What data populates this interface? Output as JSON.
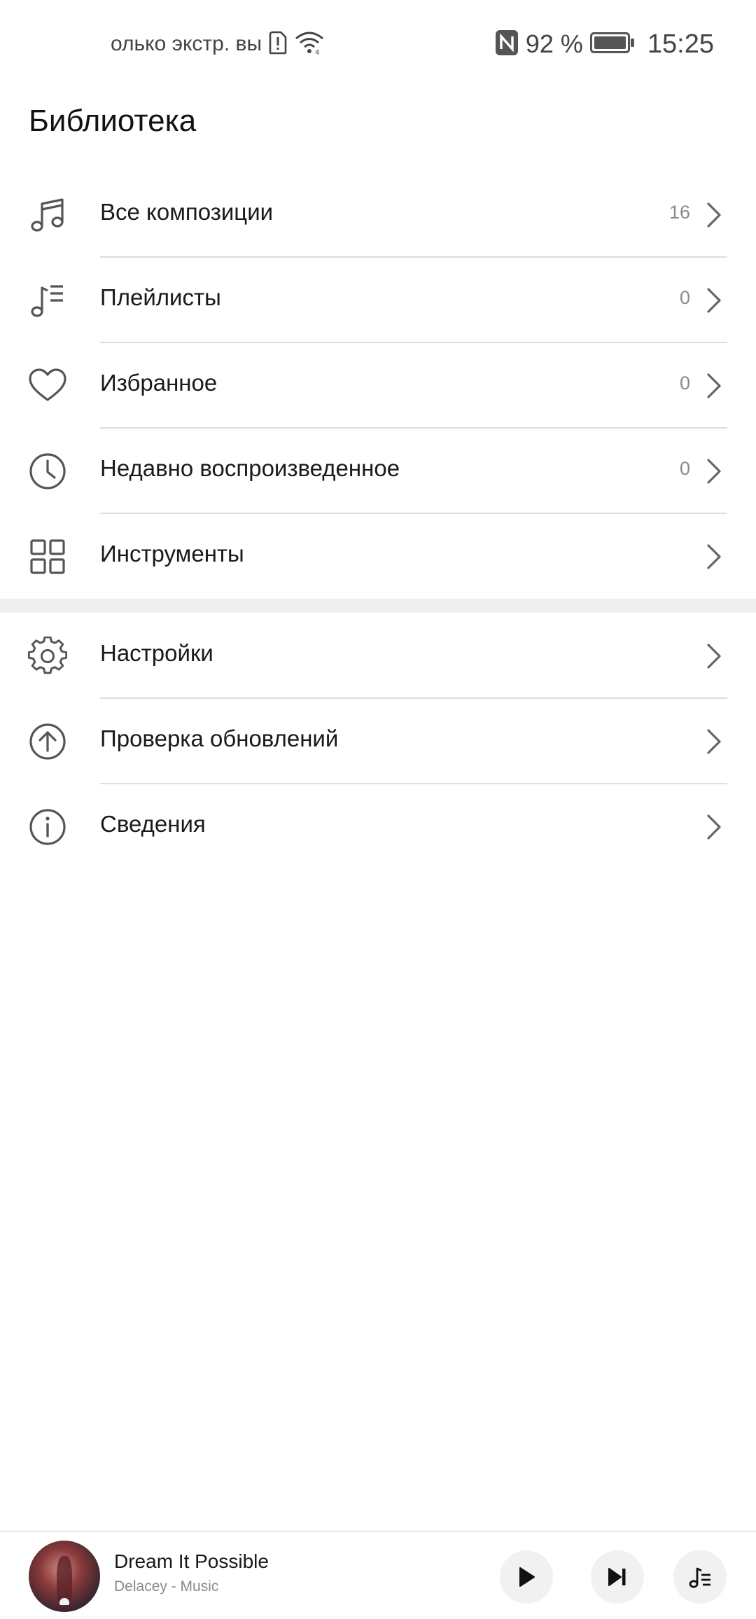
{
  "status_bar": {
    "notification_text": "олько экстр. вы",
    "battery_percent": "92 %",
    "time": "15:25",
    "icons": [
      "sim-alert-icon",
      "wifi-icon",
      "nfc-icon",
      "battery-icon"
    ]
  },
  "page": {
    "title": "Библиотека"
  },
  "library_items": [
    {
      "label": "Все композиции",
      "count": "16",
      "icon": "music-note-icon"
    },
    {
      "label": "Плейлисты",
      "count": "0",
      "icon": "playlist-icon"
    },
    {
      "label": "Избранное",
      "count": "0",
      "icon": "heart-icon"
    },
    {
      "label": "Недавно воспроизведенное",
      "count": "0",
      "icon": "clock-icon"
    },
    {
      "label": "Инструменты",
      "count": "",
      "icon": "grid-icon"
    }
  ],
  "settings_items": [
    {
      "label": "Настройки",
      "icon": "gear-icon"
    },
    {
      "label": "Проверка обновлений",
      "icon": "upload-arrow-icon"
    },
    {
      "label": "Сведения",
      "icon": "info-icon"
    }
  ],
  "mini_player": {
    "title": "Dream It Possible",
    "subtitle": "Delacey - Music",
    "controls": [
      "play-icon",
      "skip-next-icon",
      "queue-icon"
    ]
  },
  "colors": {
    "text_primary": "#1a1a1a",
    "text_secondary": "#8a8a8a",
    "divider": "#dedede",
    "icon": "#555555",
    "section_gap": "#efefef"
  }
}
